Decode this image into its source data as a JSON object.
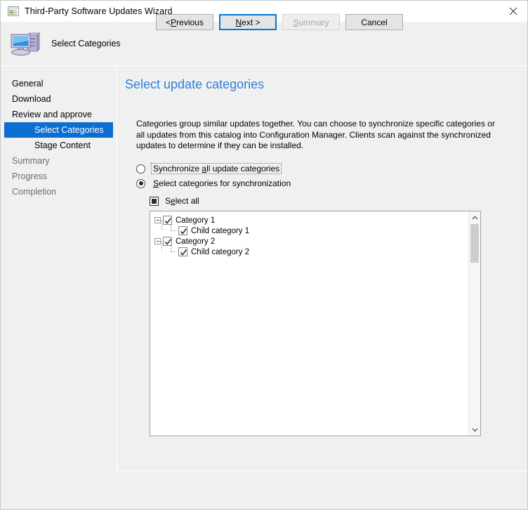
{
  "window": {
    "title": "Third-Party Software Updates Wizard",
    "titlebar_icon": "window-plus-icon",
    "close_icon": "close-icon"
  },
  "header": {
    "title": "Select Categories",
    "icon": "computer-icon"
  },
  "sidebar": {
    "items": [
      {
        "label": "General",
        "state": "done",
        "indent": 0
      },
      {
        "label": "Download",
        "state": "done",
        "indent": 0
      },
      {
        "label": "Review and approve",
        "state": "done",
        "indent": 0
      },
      {
        "label": "Select Categories",
        "state": "selected",
        "indent": 1
      },
      {
        "label": "Stage Content",
        "state": "active",
        "indent": 1
      },
      {
        "label": "Summary",
        "state": "disabled",
        "indent": 0
      },
      {
        "label": "Progress",
        "state": "disabled",
        "indent": 0
      },
      {
        "label": "Completion",
        "state": "disabled",
        "indent": 0
      }
    ]
  },
  "main": {
    "heading": "Select update categories",
    "description": "Categories group similar updates together. You can choose to synchronize specific categories or all updates from this catalog into Configuration Manager. Clients scan against the synchronized updates to determine if they can be installed.",
    "radio_sync_all": {
      "label_pre": "Synchronize ",
      "label_acc": "a",
      "label_post": "ll update categories",
      "selected": false,
      "focused": true
    },
    "radio_select_categories": {
      "label_acc": "S",
      "label_post": "elect categories for synchronization",
      "selected": true,
      "focused": false
    },
    "select_all": {
      "label_pre": "S",
      "label_acc": "e",
      "label_post": "lect all",
      "state": "indeterminate"
    },
    "tree": {
      "nodes": [
        {
          "label": "Category 1",
          "level": 0,
          "checked": true,
          "expanded": true
        },
        {
          "label": "Child category 1",
          "level": 1,
          "checked": true
        },
        {
          "label": "Category 2",
          "level": 0,
          "checked": true,
          "expanded": true
        },
        {
          "label": "Child category 2",
          "level": 1,
          "checked": true
        }
      ]
    },
    "scrollbar": {
      "up_icon": "chevron-up-icon",
      "down_icon": "chevron-down-icon"
    }
  },
  "footer": {
    "previous": {
      "pre": "< ",
      "acc": "P",
      "post": "revious",
      "disabled": false
    },
    "next": {
      "pre": "",
      "acc": "N",
      "post": "ext >",
      "disabled": false,
      "focused": true
    },
    "summary": {
      "pre": "",
      "acc": "S",
      "post": "ummary",
      "disabled": true
    },
    "cancel": {
      "pre": "",
      "acc": "",
      "post": "Cancel",
      "disabled": false
    }
  },
  "colors": {
    "accent_heading": "#2e80d8",
    "selection": "#0b6ed0",
    "focus_border": "#0078d7",
    "window_bg": "#f0f0f0"
  }
}
